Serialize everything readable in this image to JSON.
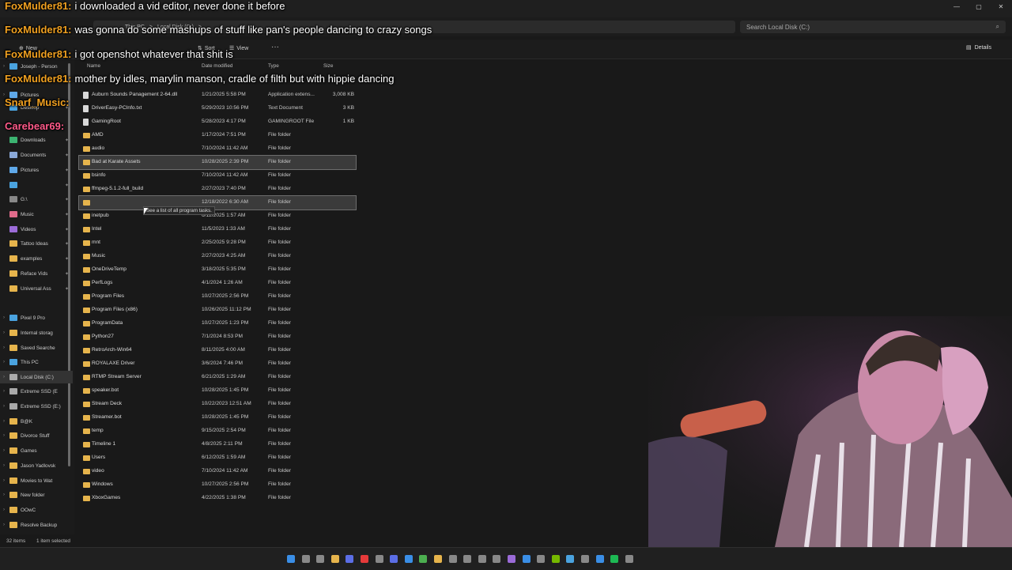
{
  "address": {
    "breadcrumb": [
      "This PC",
      ">",
      "Local Disk (C:)",
      ">"
    ],
    "search_placeholder": "Search Local Disk (C:)"
  },
  "commands": {
    "new": "New",
    "sort": "Sort",
    "view": "View",
    "more": "···",
    "details": "Details"
  },
  "columns": {
    "name": "Name",
    "date": "Date modified",
    "type": "Type",
    "size": "Size"
  },
  "sidebar": {
    "items": [
      {
        "label": "Joseph - Person",
        "icon": "cloud-icon",
        "color": "#4aa3df"
      },
      {
        "label": "Pictures",
        "icon": "pictures-icon",
        "color": "#5fa8e8"
      },
      {
        "label": "Desktop",
        "icon": "desktop-icon",
        "color": "#4aa3df"
      },
      {
        "label": "Downloads",
        "icon": "downloads-icon",
        "color": "#3cb371"
      },
      {
        "label": "Documents",
        "icon": "documents-icon",
        "color": "#8aa8d8"
      },
      {
        "label": "Pictures",
        "icon": "pictures-icon",
        "color": "#5fa8e8"
      },
      {
        "label": "",
        "icon": "drive-icon",
        "color": "#4aa3df"
      },
      {
        "label": "G:\\",
        "icon": "drive-icon",
        "color": "#888888"
      },
      {
        "label": "Music",
        "icon": "music-icon",
        "color": "#e06b8b"
      },
      {
        "label": "Videos",
        "icon": "videos-icon",
        "color": "#9b6bd8"
      },
      {
        "label": "Tattoo Ideas",
        "icon": "folder-icon",
        "color": "#e6b44c"
      },
      {
        "label": "examples",
        "icon": "folder-icon",
        "color": "#e6b44c"
      },
      {
        "label": "Reface Vids",
        "icon": "folder-icon",
        "color": "#e6b44c"
      },
      {
        "label": "Universal Ass",
        "icon": "folder-icon",
        "color": "#e6b44c"
      },
      {
        "label": "Pixel 9 Pro",
        "icon": "phone-icon",
        "color": "#4aa3df"
      },
      {
        "label": "Internal storag",
        "icon": "folder-icon",
        "color": "#e6b44c"
      },
      {
        "label": "Saved Searche",
        "icon": "folder-icon",
        "color": "#e6b44c"
      },
      {
        "label": "This PC",
        "icon": "pc-icon",
        "color": "#4aa3df"
      },
      {
        "label": "Local Disk (C:)",
        "icon": "drive-icon",
        "color": "#aaaaaa"
      },
      {
        "label": "Extreme SSD (E",
        "icon": "drive-icon",
        "color": "#aaaaaa"
      },
      {
        "label": "Extreme SSD (E:)",
        "icon": "drive-icon",
        "color": "#aaaaaa"
      },
      {
        "label": "B@K",
        "icon": "folder-icon",
        "color": "#e6b44c"
      },
      {
        "label": "Divorce Stuff",
        "icon": "folder-icon",
        "color": "#e6b44c"
      },
      {
        "label": "Games",
        "icon": "folder-icon",
        "color": "#e6b44c"
      },
      {
        "label": "Jason Yadlovsk",
        "icon": "folder-icon",
        "color": "#e6b44c"
      },
      {
        "label": "Movies to Wat",
        "icon": "folder-icon",
        "color": "#e6b44c"
      },
      {
        "label": "New folder",
        "icon": "folder-icon",
        "color": "#e6b44c"
      },
      {
        "label": "OOwC",
        "icon": "folder-icon",
        "color": "#e6b44c"
      },
      {
        "label": "Resolve Backup",
        "icon": "folder-icon",
        "color": "#e6b44c"
      }
    ]
  },
  "files": [
    {
      "name": "Auburn Sounds Panagement 2-64.dll",
      "date": "1/21/2025 5:58 PM",
      "type": "Application extens...",
      "size": "3,008 KB",
      "kind": "doc"
    },
    {
      "name": "DriverEasy-PCInfo.txt",
      "date": "5/29/2023 10:56 PM",
      "type": "Text Document",
      "size": "3 KB",
      "kind": "doc"
    },
    {
      "name": "GamingRoot",
      "date": "5/28/2023 4:17 PM",
      "type": "GAMINGROOT File",
      "size": "1 KB",
      "kind": "doc"
    },
    {
      "name": "AMD",
      "date": "1/17/2024 7:51 PM",
      "type": "File folder",
      "size": "",
      "kind": "folder"
    },
    {
      "name": "audio",
      "date": "7/10/2024 11:42 AM",
      "type": "File folder",
      "size": "",
      "kind": "folder"
    },
    {
      "name": "Bad at Karate Assets",
      "date": "10/28/2025 2:39 PM",
      "type": "File folder",
      "size": "",
      "kind": "folder",
      "selected": true
    },
    {
      "name": "bsinfo",
      "date": "7/10/2024 11:42 AM",
      "type": "File folder",
      "size": "",
      "kind": "folder"
    },
    {
      "name": "ffmpeg-5.1.2-full_build",
      "date": "2/27/2023 7:40 PM",
      "type": "File folder",
      "size": "",
      "kind": "folder"
    },
    {
      "name": "",
      "date": "12/18/2022 6:30 AM",
      "type": "File folder",
      "size": "",
      "kind": "folder",
      "selected": true
    },
    {
      "name": "inetpub",
      "date": "6/12/2025 1:57 AM",
      "type": "File folder",
      "size": "",
      "kind": "folder"
    },
    {
      "name": "Intel",
      "date": "11/5/2023 1:33 AM",
      "type": "File folder",
      "size": "",
      "kind": "folder"
    },
    {
      "name": "mnt",
      "date": "2/25/2025 9:28 PM",
      "type": "File folder",
      "size": "",
      "kind": "folder"
    },
    {
      "name": "Music",
      "date": "2/27/2023 4:25 AM",
      "type": "File folder",
      "size": "",
      "kind": "folder"
    },
    {
      "name": "OneDriveTemp",
      "date": "3/18/2025 5:35 PM",
      "type": "File folder",
      "size": "",
      "kind": "folder"
    },
    {
      "name": "PerfLogs",
      "date": "4/1/2024 1:26 AM",
      "type": "File folder",
      "size": "",
      "kind": "folder"
    },
    {
      "name": "Program Files",
      "date": "10/27/2025 2:56 PM",
      "type": "File folder",
      "size": "",
      "kind": "folder"
    },
    {
      "name": "Program Files (x86)",
      "date": "10/26/2025 11:12 PM",
      "type": "File folder",
      "size": "",
      "kind": "folder"
    },
    {
      "name": "ProgramData",
      "date": "10/27/2025 1:23 PM",
      "type": "File folder",
      "size": "",
      "kind": "folder"
    },
    {
      "name": "Python27",
      "date": "7/1/2024 8:53 PM",
      "type": "File folder",
      "size": "",
      "kind": "folder"
    },
    {
      "name": "RetroArch-Win64",
      "date": "8/11/2025 4:00 AM",
      "type": "File folder",
      "size": "",
      "kind": "folder"
    },
    {
      "name": "ROYALAXE Driver",
      "date": "3/6/2024 7:46 PM",
      "type": "File folder",
      "size": "",
      "kind": "folder"
    },
    {
      "name": "RTMP Stream Server",
      "date": "6/21/2025 1:29 AM",
      "type": "File folder",
      "size": "",
      "kind": "folder"
    },
    {
      "name": "speaker.bot",
      "date": "10/28/2025 1:45 PM",
      "type": "File folder",
      "size": "",
      "kind": "folder"
    },
    {
      "name": "Stream Deck",
      "date": "10/22/2023 12:51 AM",
      "type": "File folder",
      "size": "",
      "kind": "folder"
    },
    {
      "name": "Streamer.bot",
      "date": "10/28/2025 1:45 PM",
      "type": "File folder",
      "size": "",
      "kind": "folder"
    },
    {
      "name": "temp",
      "date": "9/15/2025 2:54 PM",
      "type": "File folder",
      "size": "",
      "kind": "folder"
    },
    {
      "name": "Timeline 1",
      "date": "4/8/2025 2:11 PM",
      "type": "File folder",
      "size": "",
      "kind": "folder"
    },
    {
      "name": "Users",
      "date": "6/12/2025 1:59 AM",
      "type": "File folder",
      "size": "",
      "kind": "folder"
    },
    {
      "name": "video",
      "date": "7/10/2024 11:42 AM",
      "type": "File folder",
      "size": "",
      "kind": "folder"
    },
    {
      "name": "Windows",
      "date": "10/27/2025 2:56 PM",
      "type": "File folder",
      "size": "",
      "kind": "folder"
    },
    {
      "name": "XboxGames",
      "date": "4/22/2025 1:38 PM",
      "type": "File folder",
      "size": "",
      "kind": "folder"
    }
  ],
  "tooltip": "See a list of all program tasks.",
  "status": {
    "count": "32 items",
    "selected": "1 item selected"
  },
  "chat": [
    {
      "user": "FoxMulder81:",
      "msg": "i downloaded a vid editor, never done it before",
      "color": "#f0a020"
    },
    {
      "user": "FoxMulder81:",
      "msg": "was gonna do some mashups of stuff like pan's people dancing to crazy songs",
      "color": "#f0a020"
    },
    {
      "user": "FoxMulder81:",
      "msg": "i got openshot whatever that shit is",
      "color": "#f0a020"
    },
    {
      "user": "FoxMulder81:",
      "msg": "mother by idles, marylin manson, cradle of filth but with hippie dancing",
      "color": "#f0a020"
    },
    {
      "user": "Snarf_Music:",
      "msg": "",
      "color": "#f0a020"
    },
    {
      "user": "Carebear69:",
      "msg": "",
      "color": "#ff5a8a"
    }
  ],
  "taskbar_colors": [
    "#3a8ee6",
    "#888888",
    "#888888",
    "#e6b44c",
    "#5b6ee6",
    "#e63a3a",
    "#888888",
    "#5b6ee6",
    "#3a8ee6",
    "#4caf50",
    "#e6b44c",
    "#888888",
    "#888888",
    "#888888",
    "#888888",
    "#9b6bd8",
    "#3a8ee6",
    "#888888",
    "#76b900",
    "#4aa3df",
    "#888888",
    "#3a8ee6",
    "#1db954",
    "#888888"
  ]
}
